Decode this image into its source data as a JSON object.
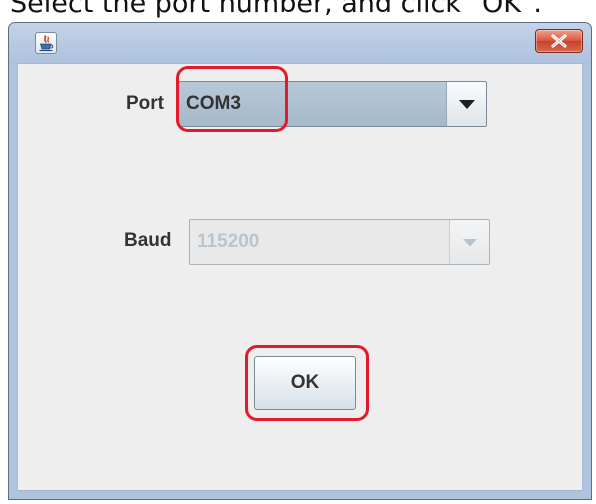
{
  "caption": "Select the port number, and click \"OK\".",
  "window": {
    "title": "",
    "app_icon": "java-cup-icon",
    "close_icon": "close-x-icon"
  },
  "form": {
    "port": {
      "label": "Port",
      "selected": "COM3",
      "arrow_icon": "dropdown-arrow-icon",
      "enabled": true
    },
    "baud": {
      "label": "Baud",
      "selected": "115200",
      "arrow_icon": "dropdown-arrow-icon",
      "enabled": false
    },
    "ok_label": "OK"
  },
  "colors": {
    "highlight": "#e21a2a",
    "titlebar": "#b9cbe2",
    "close_button": "#d7553b",
    "dialog_background": "#eeeeee",
    "port_combo_fill": "#aec0d2",
    "disabled_text": "#b8c5d2"
  }
}
